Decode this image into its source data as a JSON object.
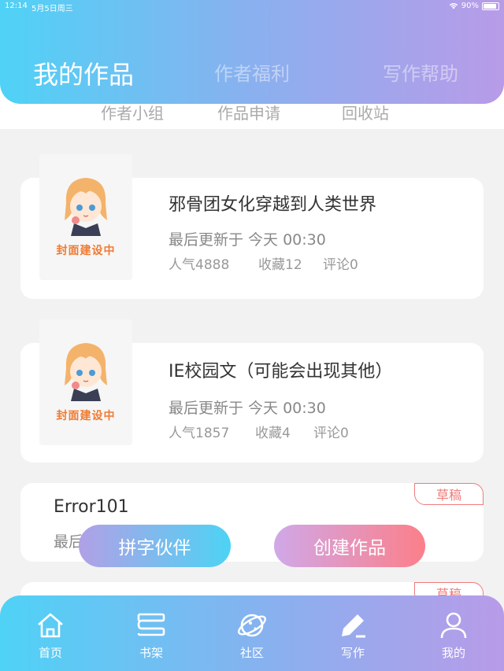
{
  "status_bar": {
    "time": "12:14",
    "date": "5月5日周三",
    "battery": "90%",
    "battery_level": 0.9
  },
  "main_tabs": [
    {
      "label": "我的作品",
      "active": true
    },
    {
      "label": "作者福利",
      "active": false
    },
    {
      "label": "写作帮助",
      "active": false
    }
  ],
  "sub_tabs": [
    {
      "label": "作者小组"
    },
    {
      "label": "作品申请"
    },
    {
      "label": "回收站"
    }
  ],
  "works": [
    {
      "cover_label": "封面建设中",
      "title": "邪骨团女化穿越到人类世界",
      "updated": "最后更新于 今天 00:30",
      "popularity": "人气4888",
      "favorites": "收藏12",
      "comments": "评论0"
    },
    {
      "cover_label": "封面建设中",
      "title": "IE校园文（可能会出现其他）",
      "updated": "最后更新于 今天 00:30",
      "popularity": "人气1857",
      "favorites": "收藏4",
      "comments": "评论0"
    },
    {
      "title": "Error101",
      "updated": "最后",
      "badge": "草稿"
    },
    {
      "badge": "草稿"
    }
  ],
  "floating_buttons": {
    "partner": "拼字伙伴",
    "create": "创建作品"
  },
  "bottom_nav": [
    {
      "label": "首页",
      "icon": "home-icon"
    },
    {
      "label": "书架",
      "icon": "bookshelf-icon"
    },
    {
      "label": "社区",
      "icon": "planet-icon"
    },
    {
      "label": "写作",
      "icon": "pen-icon",
      "active": true
    },
    {
      "label": "我的",
      "icon": "user-icon"
    }
  ],
  "colors": {
    "gradient_start": "#4fd2f6",
    "gradient_end": "#b89be8",
    "draft_badge": "#f07b7b",
    "cover_label": "#f07a32",
    "create_gradient_end": "#fc7f8a"
  }
}
